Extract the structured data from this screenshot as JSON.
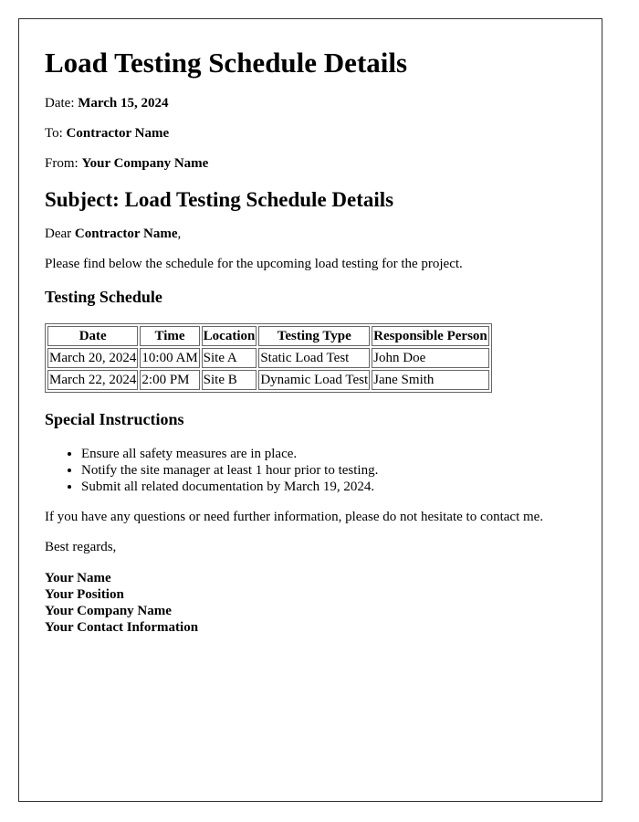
{
  "title": "Load Testing Schedule Details",
  "meta": {
    "date_label": "Date: ",
    "date_value": "March 15, 2024",
    "to_label": "To: ",
    "to_value": "Contractor Name",
    "from_label": "From: ",
    "from_value": "Your Company Name"
  },
  "subject": "Subject: Load Testing Schedule Details",
  "greeting": {
    "prefix": "Dear ",
    "name": "Contractor Name",
    "suffix": ","
  },
  "intro": "Please find below the schedule for the upcoming load testing for the project.",
  "schedule": {
    "heading": "Testing Schedule",
    "columns": [
      "Date",
      "Time",
      "Location",
      "Testing Type",
      "Responsible Person"
    ],
    "rows": [
      [
        "March 20, 2024",
        "10:00 AM",
        "Site A",
        "Static Load Test",
        "John Doe"
      ],
      [
        "March 22, 2024",
        "2:00 PM",
        "Site B",
        "Dynamic Load Test",
        "Jane Smith"
      ]
    ]
  },
  "instructions": {
    "heading": "Special Instructions",
    "items": [
      "Ensure all safety measures are in place.",
      "Notify the site manager at least 1 hour prior to testing.",
      "Submit all related documentation by March 19, 2024."
    ]
  },
  "closing_text": "If you have any questions or need further information, please do not hesitate to contact me.",
  "sign_off": "Best regards,",
  "signature": {
    "name": "Your Name",
    "position": "Your Position",
    "company": "Your Company Name",
    "contact": "Your Contact Information"
  }
}
